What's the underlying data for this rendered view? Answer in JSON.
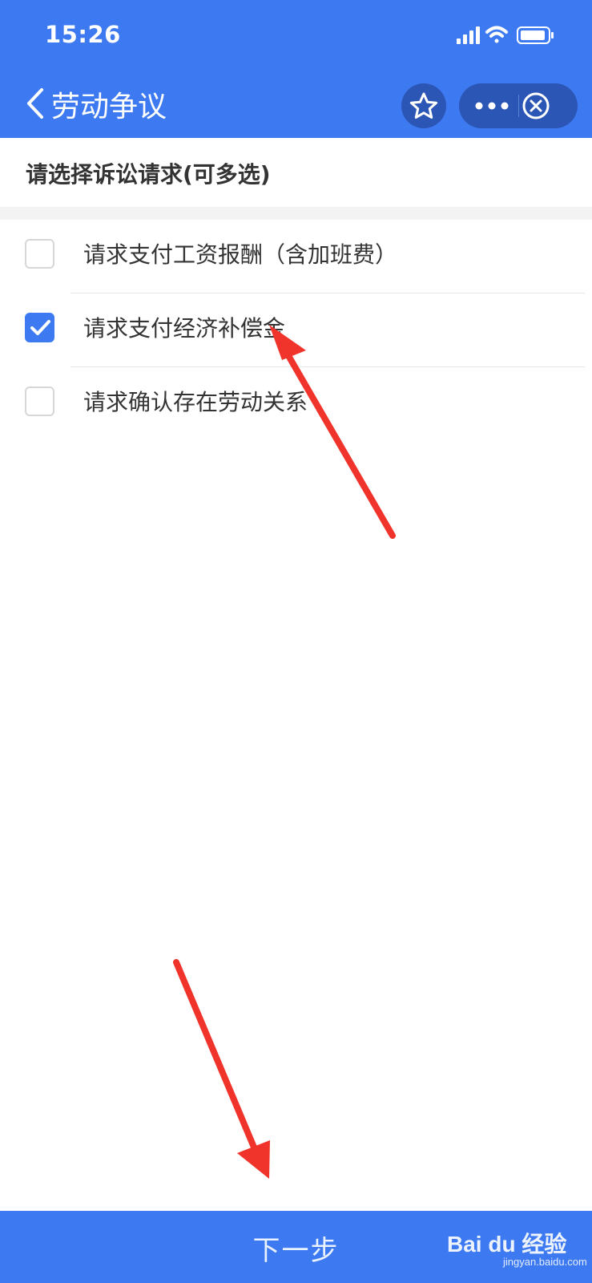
{
  "status_bar": {
    "time": "15:26",
    "icons": [
      "signal-icon",
      "wifi-icon",
      "battery-icon"
    ]
  },
  "nav": {
    "title": "劳动争议",
    "back_icon": "chevron-left-icon",
    "star_icon": "star-icon",
    "more_icon": "more-dots-icon",
    "close_icon": "close-circle-icon"
  },
  "section": {
    "title": "请选择诉讼请求(可多选)"
  },
  "options": [
    {
      "label": "请求支付工资报酬（含加班费）",
      "checked": false
    },
    {
      "label": "请求支付经济补偿金",
      "checked": true
    },
    {
      "label": "请求确认存在劳动关系",
      "checked": false
    }
  ],
  "footer": {
    "next_label": "下一步"
  },
  "watermark": {
    "brand": "Bai du 经验",
    "url": "jingyan.baidu.com"
  },
  "colors": {
    "primary": "#3d7af2",
    "capsule": "#2c56b5",
    "annotation_arrow": "#f0332b"
  }
}
